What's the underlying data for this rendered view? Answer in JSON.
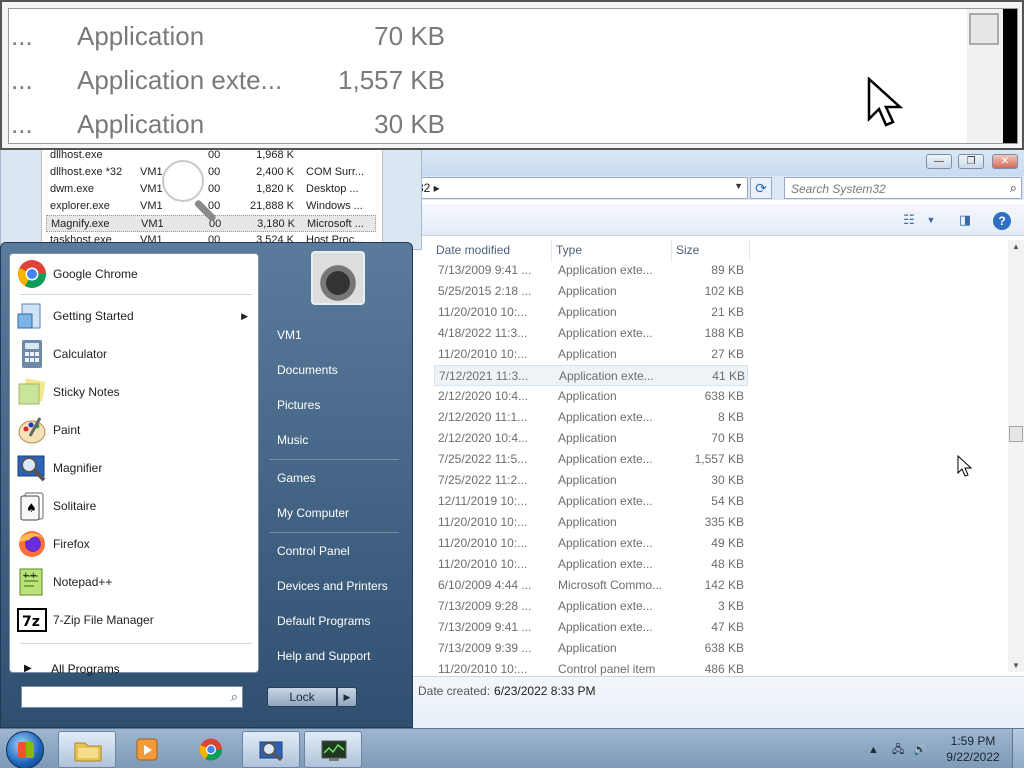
{
  "magnifier": {
    "rows": [
      {
        "ellipsis": "...",
        "type": "Application",
        "size": "70 KB"
      },
      {
        "ellipsis": "...",
        "type": "Application exte...",
        "size": "1,557 KB"
      },
      {
        "ellipsis": "...",
        "type": "Application",
        "size": "30 KB"
      }
    ]
  },
  "taskmgr": {
    "processes": [
      {
        "name": "dllhost.exe",
        "user": "",
        "cpu": "00",
        "mem": "1,968 K",
        "desc": ""
      },
      {
        "name": "dllhost.exe *32",
        "user": "VM1",
        "cpu": "00",
        "mem": "2,400 K",
        "desc": "COM Surr..."
      },
      {
        "name": "dwm.exe",
        "user": "VM1",
        "cpu": "00",
        "mem": "1,820 K",
        "desc": "Desktop ..."
      },
      {
        "name": "explorer.exe",
        "user": "VM1",
        "cpu": "00",
        "mem": "21,888 K",
        "desc": "Windows ..."
      },
      {
        "name": "Magnify.exe",
        "user": "VM1",
        "cpu": "00",
        "mem": "3,180 K",
        "desc": "Microsoft ..."
      },
      {
        "name": "taskhost.exe",
        "user": "VM1",
        "cpu": "00",
        "mem": "3,524 K",
        "desc": "Host Proc..."
      }
    ]
  },
  "explorer": {
    "window_buttons": {
      "minimize": "—",
      "maximize": "❐",
      "close": "✕"
    },
    "address_tail": "32 ▸",
    "search_placeholder": "Search System32",
    "columns": {
      "date": "Date modified",
      "type": "Type",
      "size": "Size"
    },
    "files": [
      {
        "date": "7/13/2009 9:41 ...",
        "type": "Application exte...",
        "size": "89 KB"
      },
      {
        "date": "5/25/2015 2:18 ...",
        "type": "Application",
        "size": "102 KB"
      },
      {
        "date": "11/20/2010 10:...",
        "type": "Application",
        "size": "21 KB"
      },
      {
        "date": "4/18/2022 11:3...",
        "type": "Application exte...",
        "size": "188 KB"
      },
      {
        "date": "11/20/2010 10:...",
        "type": "Application",
        "size": "27 KB"
      },
      {
        "date": "7/12/2021 11:3...",
        "type": "Application exte...",
        "size": "41 KB"
      },
      {
        "date": "2/12/2020 10:4...",
        "type": "Application",
        "size": "638 KB"
      },
      {
        "date": "2/12/2020 11:1...",
        "type": "Application exte...",
        "size": "8 KB"
      },
      {
        "date": "2/12/2020 10:4...",
        "type": "Application",
        "size": "70 KB"
      },
      {
        "date": "7/25/2022 11:5...",
        "type": "Application exte...",
        "size": "1,557 KB"
      },
      {
        "date": "7/25/2022 11:2...",
        "type": "Application",
        "size": "30 KB"
      },
      {
        "date": "12/11/2019 10:...",
        "type": "Application exte...",
        "size": "54 KB"
      },
      {
        "date": "11/20/2010 10:...",
        "type": "Application",
        "size": "335 KB"
      },
      {
        "date": "11/20/2010 10:...",
        "type": "Application exte...",
        "size": "49 KB"
      },
      {
        "date": "11/20/2010 10:...",
        "type": "Application exte...",
        "size": "48 KB"
      },
      {
        "date": "6/10/2009 4:44 ...",
        "type": "Microsoft Commo...",
        "size": "142 KB"
      },
      {
        "date": "7/13/2009 9:28 ...",
        "type": "Application exte...",
        "size": "3 KB"
      },
      {
        "date": "7/13/2009 9:41 ...",
        "type": "Application exte...",
        "size": "47 KB"
      },
      {
        "date": "7/13/2009 9:39 ...",
        "type": "Application",
        "size": "638 KB"
      },
      {
        "date": "11/20/2010 10:...",
        "type": "Control panel item",
        "size": "486 KB"
      }
    ],
    "details": {
      "label": "Date created:",
      "value": "6/23/2022 8:33 PM"
    }
  },
  "start_menu": {
    "programs": [
      {
        "name": "Google Chrome",
        "icon": "chrome-icon"
      },
      {
        "name": "Getting Started",
        "icon": "getting-started-icon",
        "submenu": "▶"
      },
      {
        "name": "Calculator",
        "icon": "calculator-icon"
      },
      {
        "name": "Sticky Notes",
        "icon": "sticky-notes-icon"
      },
      {
        "name": "Paint",
        "icon": "paint-icon"
      },
      {
        "name": "Magnifier",
        "icon": "magnifier-icon"
      },
      {
        "name": "Solitaire",
        "icon": "solitaire-icon"
      },
      {
        "name": "Firefox",
        "icon": "firefox-icon"
      },
      {
        "name": "Notepad++",
        "icon": "notepadpp-icon"
      },
      {
        "name": "7-Zip File Manager",
        "icon": "7zip-icon",
        "glyph": "7z"
      }
    ],
    "all_programs": "All Programs",
    "right_links": [
      "VM1",
      "Documents",
      "Pictures",
      "Music",
      "Games",
      "My Computer",
      "Control Panel",
      "Devices and Printers",
      "Default Programs",
      "Help and Support"
    ],
    "lock_label": "Lock"
  },
  "taskbar": {
    "time": "1:59 PM",
    "date": "9/22/2022"
  },
  "colors": {
    "taskbar": "#8aa6c3",
    "start_right_pane": "#3f5f80",
    "accent": "#2d6fc2"
  }
}
